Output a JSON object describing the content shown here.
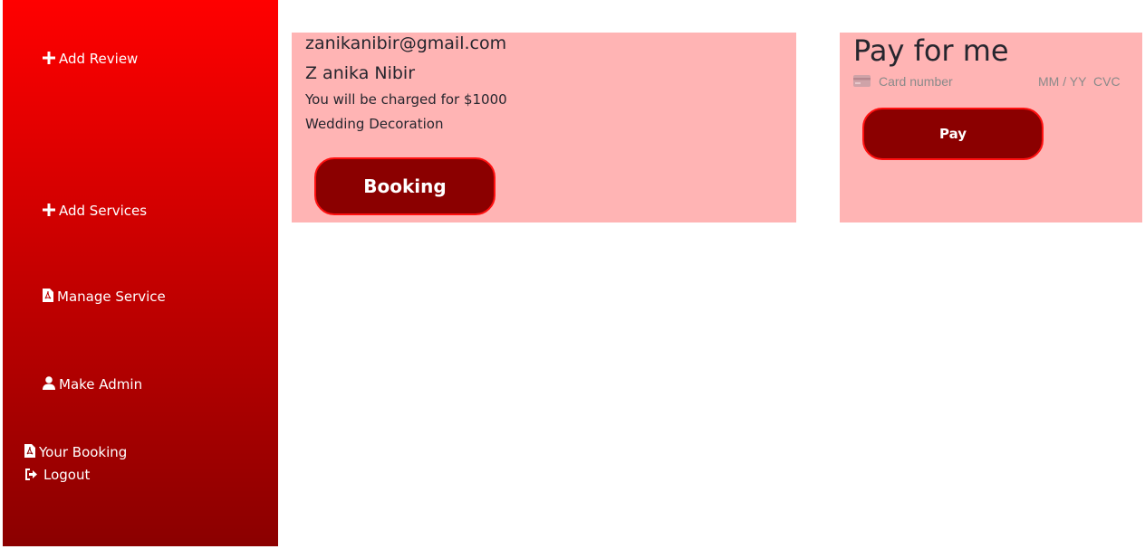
{
  "sidebar": {
    "items": [
      {
        "label": "Add Review",
        "icon": "plus-icon"
      },
      {
        "label": "Add Services",
        "icon": "plus-icon"
      },
      {
        "label": "Manage Service",
        "icon": "pdf-file-icon"
      },
      {
        "label": "Make Admin",
        "icon": "user-icon"
      },
      {
        "label": "Your Booking",
        "icon": "pdf-file-icon"
      },
      {
        "label": "Logout",
        "icon": "sign-out-icon"
      }
    ],
    "gradient_top": "#ff0000",
    "gradient_bottom": "#8b0000"
  },
  "booking": {
    "email": "zanikanibir@gmail.com",
    "name": "Z anika Nibir",
    "charge_text": "You will be charged for $1000",
    "service": "Wedding Decoration",
    "button_label": "Booking"
  },
  "payment": {
    "title": "Pay for me",
    "card_number_placeholder": "Card number",
    "expiry_placeholder": "MM / YY",
    "cvc_placeholder": "CVC",
    "button_label": "Pay"
  },
  "colors": {
    "card_bg": "#ffb4b4",
    "button_bg": "#8b0000",
    "button_border": "#ff1010",
    "text": "#26262e"
  }
}
